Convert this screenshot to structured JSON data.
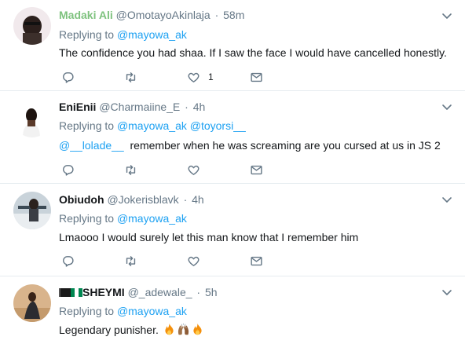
{
  "tweets": [
    {
      "name": "Madaki Ali",
      "handle": "@OmotayoAkinlaja",
      "sep": "·",
      "time": "58m",
      "replying_prefix": "Replying to",
      "replying_to": "@mayowa_ak",
      "text": "The confidence you had shaa. If I saw the face I would have cancelled honestly.",
      "like_count": "1"
    },
    {
      "name": "EniEnii",
      "handle": "@Charmaiine_E",
      "sep": "·",
      "time": "4h",
      "replying_prefix": "Replying to",
      "replying_to": "@mayowa_ak",
      "replying_to_2": "@toyorsi__",
      "mention": "@__lolade__",
      "text": "remember when he was screaming are you cursed at us in JS 2"
    },
    {
      "name": "Obiudoh",
      "handle": "@Jokerisblavk",
      "sep": "·",
      "time": "4h",
      "replying_prefix": "Replying to",
      "replying_to": "@mayowa_ak",
      "text": "Lmaooo I would surely let this man know that I remember him"
    },
    {
      "name": "SHEYMI",
      "handle": "@_adewale_",
      "sep": "·",
      "time": "5h",
      "replying_prefix": "Replying to",
      "replying_to": "@mayowa_ak",
      "text": "Legendary punisher."
    }
  ],
  "colors": {
    "name_highlight": "#7ec27e",
    "link": "#1da1f2",
    "muted": "#657786",
    "divider": "#e6ecf0"
  },
  "icons": [
    "reply-icon",
    "retweet-icon",
    "like-icon",
    "message-icon",
    "chevron-down-icon",
    "flag-icon",
    "fire-emoji",
    "raised-hands-emoji"
  ]
}
